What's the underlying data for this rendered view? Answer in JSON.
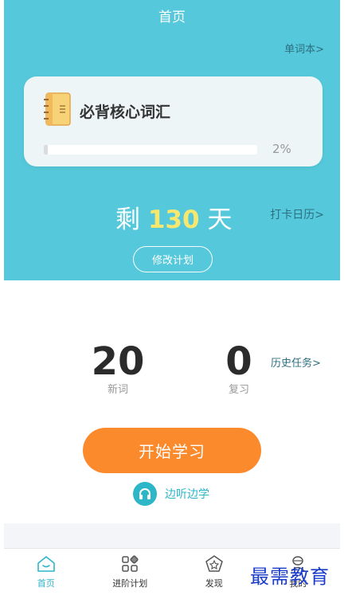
{
  "header": {
    "title": "首页",
    "vocab_link": "单词本>"
  },
  "book": {
    "title": "必背核心词汇",
    "progress_percent": 2,
    "progress_text": "2%"
  },
  "countdown": {
    "prefix": "剩",
    "days": "130",
    "suffix": "天"
  },
  "checkin_link": "打卡日历>",
  "edit_plan_label": "修改计划",
  "stats": {
    "new_words": {
      "value": "20",
      "label": "新词"
    },
    "review": {
      "value": "0",
      "label": "复习"
    }
  },
  "history_link": "历史任务>",
  "start_button": "开始学习",
  "listen": {
    "label": "边听边学"
  },
  "tabs": [
    {
      "label": "首页",
      "icon": "home-icon",
      "active": true
    },
    {
      "label": "进阶计划",
      "icon": "grid-icon",
      "active": false
    },
    {
      "label": "发现",
      "icon": "discover-icon",
      "active": false
    },
    {
      "label": "我的",
      "icon": "profile-icon",
      "active": false
    }
  ],
  "watermark": "最需教育",
  "colors": {
    "hero_bg": "#55c9db",
    "accent": "#2db5c8",
    "start_button": "#fb8a2c",
    "days_highlight": "#f6e86e"
  }
}
